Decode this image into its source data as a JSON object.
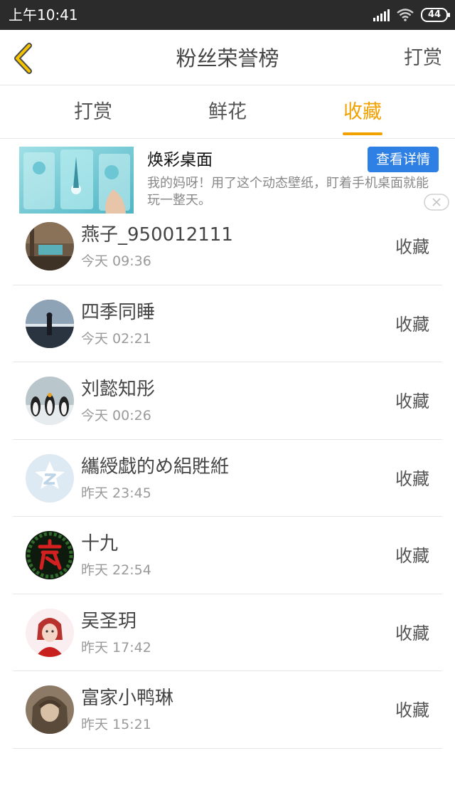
{
  "status_bar": {
    "time": "上午10:41",
    "battery": "44"
  },
  "navbar": {
    "title": "粉丝荣誉榜",
    "action": "打赏"
  },
  "tabs": [
    {
      "label": "打赏",
      "active": false
    },
    {
      "label": "鲜花",
      "active": false
    },
    {
      "label": "收藏",
      "active": true
    }
  ],
  "ad": {
    "title": "焕彩桌面",
    "button": "查看详情",
    "description": "我的妈呀！用了这个动态壁纸，盯着手机桌面就能玩一整天。"
  },
  "fans": [
    {
      "name": "燕子_950012111",
      "time": "今天 09:36",
      "action": "收藏"
    },
    {
      "name": "四季同睡",
      "time": "今天 02:21",
      "action": "收藏"
    },
    {
      "name": "刘懿知彤",
      "time": "今天 00:26",
      "action": "收藏"
    },
    {
      "name": "纗綬戱的め絽貹絍",
      "time": "昨天 23:45",
      "action": "收藏"
    },
    {
      "name": "十九",
      "time": "昨天 22:54",
      "action": "收藏"
    },
    {
      "name": "吴圣玥",
      "time": "昨天 17:42",
      "action": "收藏"
    },
    {
      "name": "富家小鸭琳",
      "time": "昨天 15:21",
      "action": "收藏"
    }
  ],
  "colors": {
    "accent": "#f2a200",
    "ad_button": "#2f80e5",
    "status_bar": "#2b2b2b"
  }
}
